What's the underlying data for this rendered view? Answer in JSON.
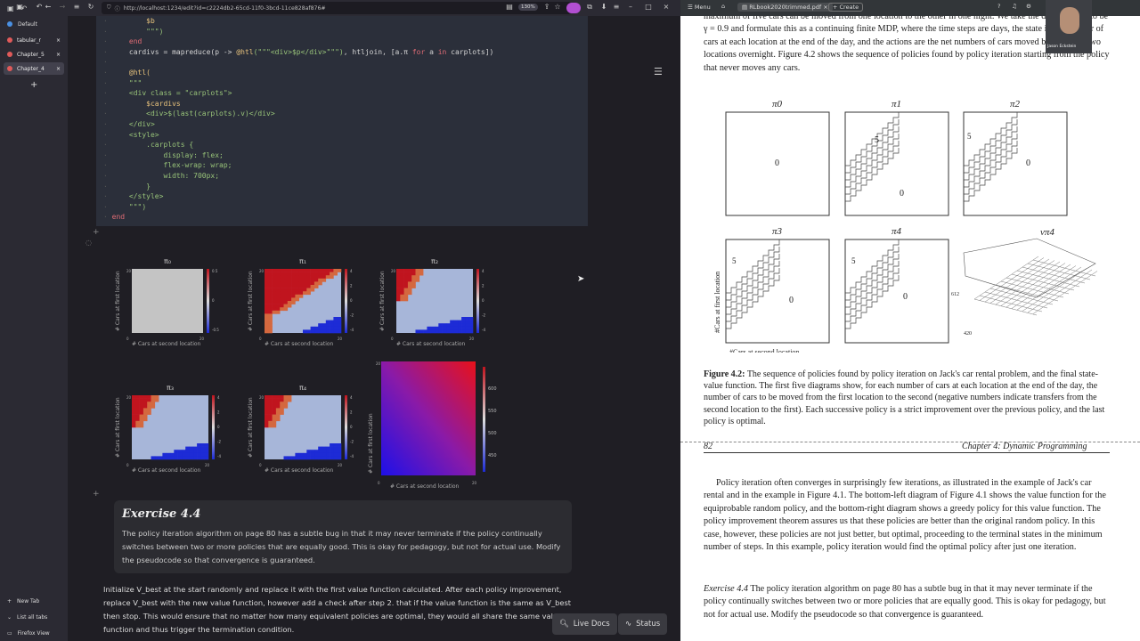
{
  "browser": {
    "url": "http://localhost:1234/edit?id=c2224db2-65cd-11f0-3bcd-11ce828af876#",
    "zoom": "130%",
    "sidebar": {
      "default_label": "Default",
      "tabs": [
        {
          "label": "tabular_r",
          "color": "#e05a5a"
        },
        {
          "label": "Chapter_5",
          "color": "#e05a5a"
        },
        {
          "label": "Chapter_4",
          "color": "#e05a5a"
        }
      ],
      "new_tab": "New Tab",
      "list_tabs": "List all tabs",
      "firefox_view": "Firefox View"
    }
  },
  "code_lines": [
    {
      "parts": [
        {
          "t": "        $b",
          "c": "mac"
        }
      ]
    },
    {
      "parts": [
        {
          "t": "        \"\"\")",
          "c": "str"
        }
      ]
    },
    {
      "parts": [
        {
          "t": "    end",
          "c": "kw"
        }
      ]
    },
    {
      "parts": [
        {
          "t": "    cardivs = mapreduce(p -> ",
          "c": ""
        },
        {
          "t": "@htl",
          "c": "mac"
        },
        {
          "t": "(\"\"\"<div>$p</div>\"\"\")",
          "c": "str"
        },
        {
          "t": ", htljoin, [a.π ",
          "c": ""
        },
        {
          "t": "for",
          "c": "kw"
        },
        {
          "t": " a ",
          "c": ""
        },
        {
          "t": "in",
          "c": "kw"
        },
        {
          "t": " carplots])",
          "c": ""
        }
      ]
    },
    {
      "parts": [
        {
          "t": "",
          "c": ""
        }
      ]
    },
    {
      "parts": [
        {
          "t": "    @htl(",
          "c": "mac"
        }
      ]
    },
    {
      "parts": [
        {
          "t": "    \"\"\"",
          "c": "str"
        }
      ]
    },
    {
      "parts": [
        {
          "t": "    <div class = \"carplots\">",
          "c": "str"
        }
      ]
    },
    {
      "parts": [
        {
          "t": "        $cardivs",
          "c": "mac"
        }
      ]
    },
    {
      "parts": [
        {
          "t": "        <div>$(last(carplots).v)</div>",
          "c": "str"
        }
      ]
    },
    {
      "parts": [
        {
          "t": "    </div>",
          "c": "str"
        }
      ]
    },
    {
      "parts": [
        {
          "t": "    <style>",
          "c": "str"
        }
      ]
    },
    {
      "parts": [
        {
          "t": "        .carplots {",
          "c": "str"
        }
      ]
    },
    {
      "parts": [
        {
          "t": "            display: flex;",
          "c": "str"
        }
      ]
    },
    {
      "parts": [
        {
          "t": "            flex-wrap: wrap;",
          "c": "str"
        }
      ]
    },
    {
      "parts": [
        {
          "t": "            width: 700px;",
          "c": "str"
        }
      ]
    },
    {
      "parts": [
        {
          "t": "        }",
          "c": "str"
        }
      ]
    },
    {
      "parts": [
        {
          "t": "    </style>",
          "c": "str"
        }
      ]
    },
    {
      "parts": [
        {
          "t": "    \"\"\")",
          "c": "str"
        }
      ]
    },
    {
      "parts": [
        {
          "t": "end",
          "c": "kw"
        }
      ]
    }
  ],
  "plots": {
    "policies": [
      {
        "title": "π₀",
        "cbar_ticks": [
          "0.5",
          "0",
          "-0.5"
        ]
      },
      {
        "title": "π₁",
        "cbar_ticks": [
          "4",
          "2",
          "0",
          "-2",
          "-4"
        ]
      },
      {
        "title": "π₂",
        "cbar_ticks": [
          "4",
          "2",
          "0",
          "-2",
          "-4"
        ]
      },
      {
        "title": "π₃",
        "cbar_ticks": [
          "4",
          "2",
          "0",
          "-2",
          "-4"
        ]
      },
      {
        "title": "π₄",
        "cbar_ticks": [
          "4",
          "2",
          "0",
          "-2",
          "-4"
        ]
      }
    ],
    "value_cbar_ticks": [
      "600",
      "550",
      "500",
      "450"
    ],
    "xlabel": "# Cars at second location",
    "ylabel": "# Cars at first location",
    "axis_min": "0",
    "axis_max": "20"
  },
  "exercise": {
    "title": "Exercise 4.4",
    "text": "The policy iteration algorithm on page 80 has a subtle bug in that it may never terminate if the policy continually switches between two or more policies that are equally good. This is okay for pedagogy, but not for actual use. Modify the pseudocode so that convergence is guaranteed."
  },
  "answer": "Initialize V_best at the start randomly and replace it with the first value function calculated. After each policy improvement, replace V_best with the new value function, however add a check after step 2. that if the value function is the same as V_best then stop. This would ensure that no matter how many equivalent policies are optimal, they would all share the same value function and thus trigger the termination condition.",
  "pluto_buttons": {
    "live_docs": "Live Docs",
    "status": "Status"
  },
  "pdf": {
    "menu": "Menu",
    "tab": "RLbook2020trimmed.pdf",
    "create": "Create",
    "webcam_name": "Jason Eckstein",
    "top_text": "maximum of five cars can be moved from one location to the other in one night. We take the discount rate to be γ = 0.9 and formulate this as a continuing finite MDP, where the time steps are days, the state is the number of cars at each location at the end of the day, and the actions are the net numbers of cars moved between the two locations overnight. Figure 4.2 shows the sequence of policies found by policy iteration starting from the policy that never moves any cars.",
    "fig_titles": [
      "π0",
      "π1",
      "π2",
      "π3",
      "π4",
      "vπ4"
    ],
    "fig_nums": [
      "0",
      "5",
      "0",
      "5",
      "0",
      "5",
      "0",
      "5",
      "0"
    ],
    "fig_ylabel": "#Cars at first location",
    "fig_xlabel": "#Cars at second location",
    "value_ticks": [
      "612",
      "420"
    ],
    "caption_label": "Figure 4.2:",
    "caption": "The sequence of policies found by policy iteration on Jack's car rental problem, and the final state-value function. The first five diagrams show, for each number of cars at each location at the end of the day, the number of cars to be moved from the first location to the second (negative numbers indicate transfers from the second location to the first). Each successive policy is a strict improvement over the previous policy, and the last policy is optimal.",
    "page_num": "82",
    "chapter": "Chapter 4: Dynamic Programming",
    "para": "Policy iteration often converges in surprisingly few iterations, as illustrated in the example of Jack's car rental and in the example in Figure 4.1. The bottom-left diagram of Figure 4.1 shows the value function for the equiprobable random policy, and the bottom-right diagram shows a greedy policy for this value function. The policy improvement theorem assures us that these policies are better than the original random policy. In this case, however, these policies are not just better, but optimal, proceeding to the terminal states in the minimum number of steps. In this example, policy iteration would find the optimal policy after just one iteration.",
    "exercise_label": "Exercise 4.4",
    "exercise_text": "The policy iteration algorithm on page 80 has a subtle bug in that it may never terminate if the policy continually switches between two or more policies that are equally good. This is okay for pedagogy, but not for actual use. Modify the pseudocode so that convergence is guaranteed."
  }
}
